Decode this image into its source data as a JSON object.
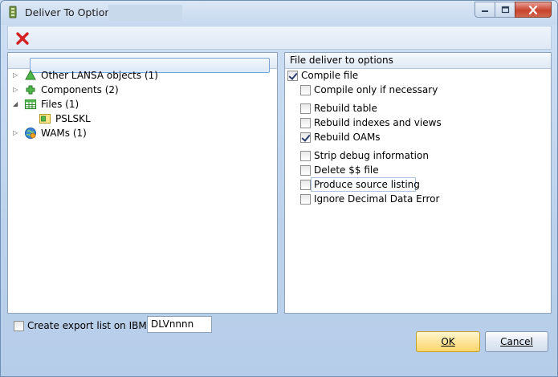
{
  "window": {
    "title": "Deliver To Options"
  },
  "tree": {
    "items": [
      {
        "label": "Other LANSA objects (1)",
        "expanded": false
      },
      {
        "label": "Components (2)",
        "expanded": false
      },
      {
        "label": "Files (1)",
        "expanded": true,
        "children": [
          {
            "label": "PSLSKL",
            "selected": true
          }
        ]
      },
      {
        "label": "WAMs (1)",
        "expanded": false
      }
    ]
  },
  "options": {
    "header": "File deliver to options",
    "compile_file": {
      "label": "Compile file",
      "checked": true
    },
    "compile_only_if_necessary": {
      "label": "Compile only if necessary",
      "checked": false
    },
    "rebuild_table": {
      "label": "Rebuild table",
      "checked": false
    },
    "rebuild_indexes_and_views": {
      "label": "Rebuild indexes and views",
      "checked": false
    },
    "rebuild_oams": {
      "label": "Rebuild OAMs",
      "checked": true
    },
    "strip_debug_information": {
      "label": "Strip debug information",
      "checked": false
    },
    "delete_ss_file": {
      "label": "Delete $$ file",
      "checked": false
    },
    "produce_source_listing": {
      "label": "Produce source listing",
      "checked": false
    },
    "ignore_decimal_data_error": {
      "label": "Ignore Decimal Data Error",
      "checked": false
    }
  },
  "export": {
    "label": "Create export list on IBM i",
    "checked": false,
    "value": "DLVnnnn"
  },
  "buttons": {
    "ok": "OK",
    "cancel": "Cancel"
  },
  "colors": {
    "delete_icon": "#d42020",
    "ok_button": "#fde59a",
    "close_button": "#c9442f"
  }
}
